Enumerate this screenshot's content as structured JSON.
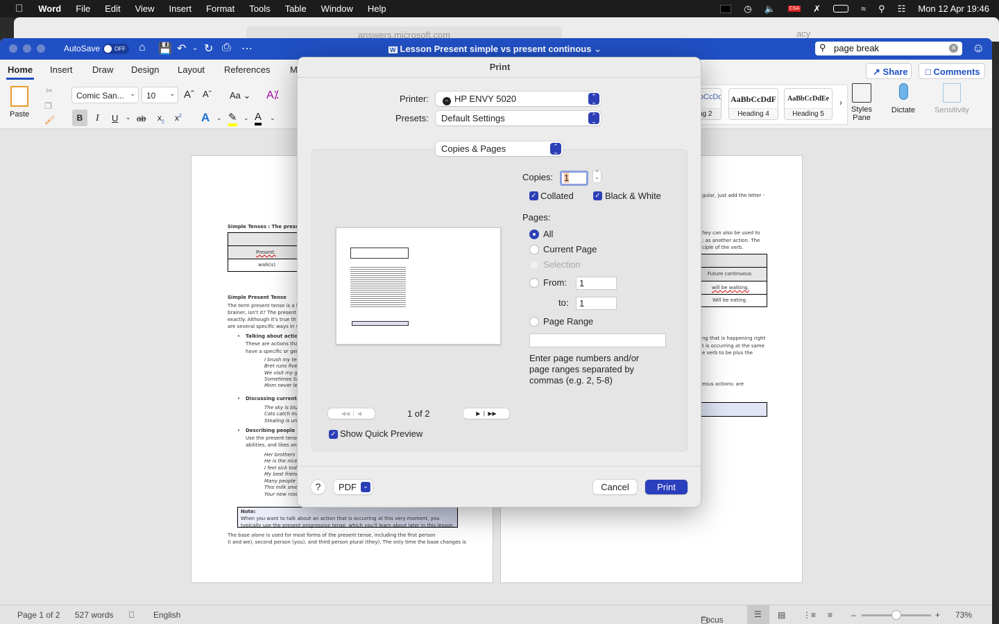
{
  "menubar": {
    "app": "Word",
    "items": [
      "File",
      "Edit",
      "View",
      "Insert",
      "Format",
      "Tools",
      "Table",
      "Window",
      "Help"
    ],
    "clock": "Mon 12 Apr  19:46",
    "csa_badge": "CSA"
  },
  "safari": {
    "url": "answers.microsoft.com",
    "tab_fragment": "acy"
  },
  "titlebar": {
    "autosave_label": "AutoSave",
    "autosave_state": "OFF",
    "doc_title": "Lesson Present simple vs present continous",
    "search_value": "page break",
    "accent": "#2150c4"
  },
  "tabs": [
    "Home",
    "Insert",
    "Draw",
    "Design",
    "Layout",
    "References",
    "M"
  ],
  "ribbon": {
    "paste": "Paste",
    "font_name": "Comic San...",
    "font_size": "10",
    "change_case": "Aa",
    "format": {
      "bold": "B",
      "italic": "I",
      "underline": "U",
      "strike": "ab",
      "sub": "x",
      "sup": "x"
    },
    "share": "Share",
    "comments": "Comments",
    "styles": [
      {
        "sample": "AaBbCcDdEe",
        "name": "ng 2"
      },
      {
        "sample": "AaBbCcDdF",
        "name": "Heading 4"
      },
      {
        "sample": "AaBbCcDdEe",
        "name": "Heading 5"
      }
    ],
    "styles_pane": "Styles Pane",
    "dictate": "Dictate",
    "sensitivity": "Sensitivity"
  },
  "left_page": {
    "lines": [
      "Simple Tenses : The present,",
      "Present.",
      "walk(s)",
      "Simple Present Tense",
      "The term present tense is a li",
      "brainer, isn't it? The present",
      "exactly. Although it's true th",
      "are several specific ways in w",
      "Talking about actions",
      "These are actions tha",
      "have a specific or gen",
      "I brush my tee",
      "Bret runs five r",
      "We visit my gra",
      "Sometimes Sea",
      "Mom never lets",
      "Discussing current fa",
      "The sky is blue,",
      "Cats catch mice",
      "Stealing is unet",
      "Describing people or t",
      "Use the present tense",
      "abilities, and likes and",
      "Her brothers a",
      "He is the nicest",
      "I feel sick toda",
      "My best friend",
      "Many people lo",
      "This milk smell",
      "Your new rose l"
    ],
    "note_title": "Note:",
    "note_lines": [
      "When you want to talk about an action that is occurring at this very moment, you",
      "typically use the present progressive tense, which you'll learn about later in this lesson."
    ],
    "body_lines": [
      "The base alone is used for most forms of the present tense, including the first person",
      "(I and we), second person (you), and third person plural (they). The only time the base changes is"
    ]
  },
  "right_page": {
    "lines": [
      "gular, just add the letter -",
      "hey can also be used to",
      ": as another action. The",
      "ciple of the verb.",
      "Future continuous",
      "will be walking.",
      "Will be eating.",
      "ng that is happening right",
      "t is occurring at the same",
      "e verb to be plus the",
      "eous actions: are"
    ]
  },
  "status": {
    "page": "Page 1 of 2",
    "words": "527 words",
    "language": "English",
    "focus": "Focus",
    "zoom": "73%",
    "zoom_percent": 73
  },
  "print_dialog": {
    "title": "Print",
    "printer_label": "Printer:",
    "printer": "HP ENVY 5020",
    "presets_label": "Presets:",
    "presets": "Default Settings",
    "section": "Copies & Pages",
    "copies_label": "Copies:",
    "copies": "1",
    "collated": {
      "label": "Collated",
      "checked": true
    },
    "black_white": {
      "label": "Black & White",
      "checked": true
    },
    "pages_label": "Pages:",
    "page_options": [
      {
        "label": "All",
        "selected": true
      },
      {
        "label": "Current Page"
      },
      {
        "label": "Selection",
        "disabled": true
      },
      {
        "label": "From:"
      },
      {
        "label": "Page Range"
      }
    ],
    "from_value": "1",
    "to_label": "to:",
    "to_value": "1",
    "range_value": "",
    "range_hint": [
      "Enter page numbers and/or",
      "page ranges separated by",
      "commas (e.g. 2, 5-8)"
    ],
    "page_indicator": "1 of 2",
    "quick_preview": {
      "label": "Show Quick Preview",
      "checked": true
    },
    "help": "?",
    "pdf": "PDF",
    "cancel": "Cancel",
    "print": "Print",
    "accent": "#2d3fb6"
  }
}
